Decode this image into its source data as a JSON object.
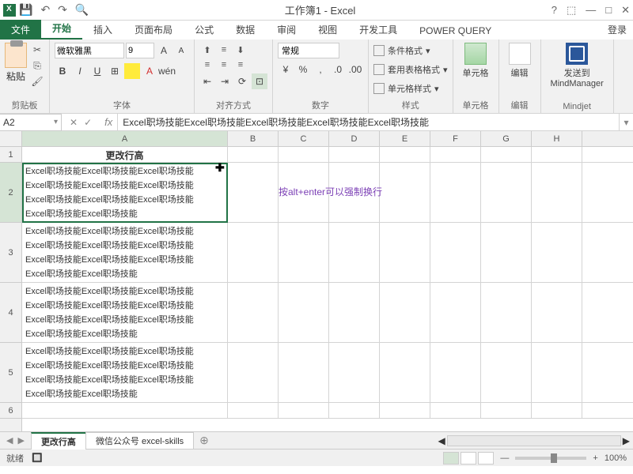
{
  "title": "工作簿1 - Excel",
  "qat": {
    "save": "💾",
    "undo": "↶",
    "redo": "↷",
    "preview": "🔍"
  },
  "win": {
    "help": "?",
    "ropt": "⬚",
    "min": "—",
    "max": "□",
    "close": "✕"
  },
  "tabs": {
    "file": "文件",
    "home": "开始",
    "insert": "插入",
    "layout": "页面布局",
    "formula": "公式",
    "data": "数据",
    "review": "审阅",
    "view": "视图",
    "dev": "开发工具",
    "pq": "POWER QUERY",
    "login": "登录"
  },
  "ribbon": {
    "clipboard": {
      "label": "剪贴板",
      "paste": "粘贴"
    },
    "font": {
      "label": "字体",
      "name": "微软雅黑",
      "size": "9",
      "grow": "A",
      "shrink": "A",
      "b": "B",
      "i": "I",
      "u": "U",
      "border": "⊞",
      "fill": "▾",
      "color": "A"
    },
    "align": {
      "label": "对齐方式"
    },
    "number": {
      "label": "数字",
      "fmt": "常规"
    },
    "styles": {
      "label": "样式",
      "cond": "条件格式",
      "tbl": "套用表格格式",
      "cell": "单元格样式"
    },
    "cells": {
      "label": "单元格",
      "btn": "单元格"
    },
    "editing": {
      "label": "编辑",
      "btn": "编辑"
    },
    "mindjet": {
      "label": "Mindjet",
      "btn": "发送到",
      "sub": "MindManager"
    }
  },
  "namebox": "A2",
  "formula": "Excel职场技能Excel职场技能Excel职场技能Excel职场技能Excel职场技能",
  "cols": [
    "A",
    "B",
    "C",
    "D",
    "E",
    "F",
    "G",
    "H"
  ],
  "rows": {
    "r1": "更改行高",
    "multi": "Excel职场技能Excel职场技能Excel职场技能\nExcel职场技能Excel职场技能Excel职场技能\nExcel职场技能Excel职场技能Excel职场技能\nExcel职场技能Excel职场技能"
  },
  "note": "按alt+enter可以强制换行",
  "sheets": {
    "s1": "更改行高",
    "s2": "微信公众号 excel-skills"
  },
  "status": {
    "ready": "就绪",
    "scroll": "",
    "zoom": "100%",
    "minus": "—",
    "plus": "+"
  }
}
